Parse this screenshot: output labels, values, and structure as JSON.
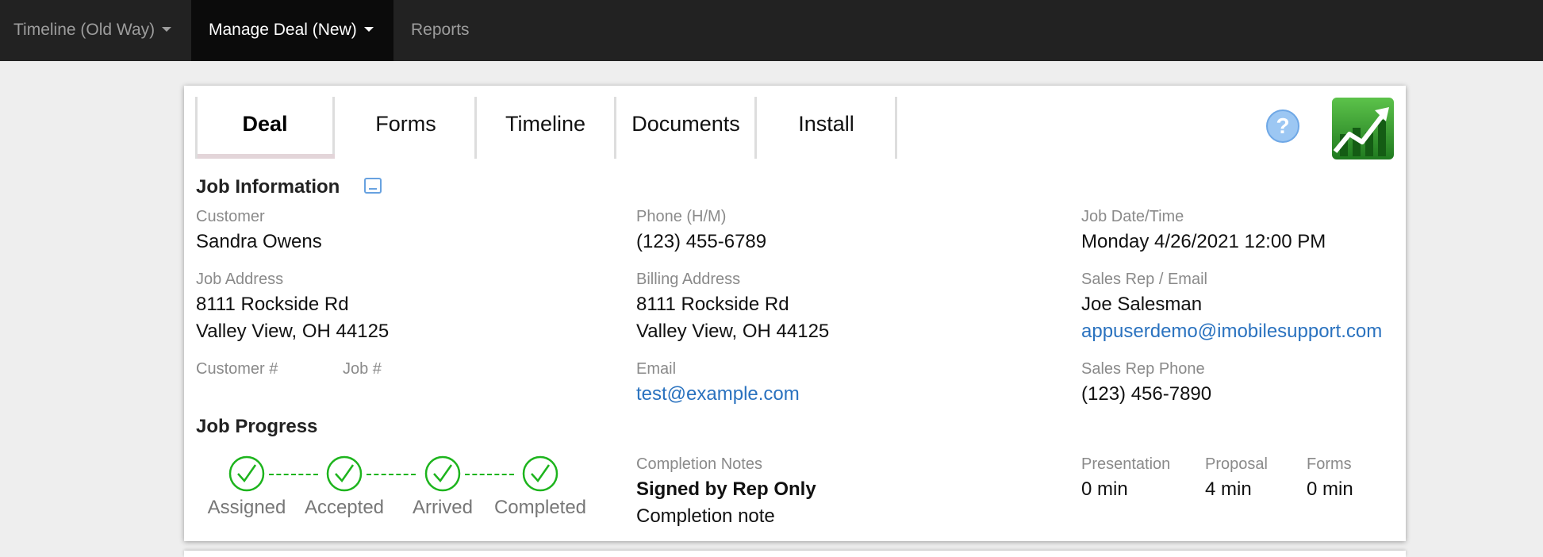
{
  "topnav": {
    "items": [
      {
        "label": "Timeline (Old Way)"
      },
      {
        "label": "Manage Deal (New)"
      },
      {
        "label": "Reports"
      }
    ]
  },
  "tabs": [
    {
      "label": "Deal"
    },
    {
      "label": "Forms"
    },
    {
      "label": "Timeline"
    },
    {
      "label": "Documents"
    },
    {
      "label": "Install"
    }
  ],
  "help": {
    "glyph": "?"
  },
  "job_info": {
    "title": "Job Information",
    "customer_label": "Customer",
    "customer": "Sandra Owens",
    "phone_label": "Phone (H/M)",
    "phone": "(123) 455-6789",
    "job_datetime_label": "Job Date/Time",
    "job_datetime": "Monday 4/26/2021 12:00 PM",
    "job_address_label": "Job Address",
    "job_address_line1": "8111 Rockside Rd",
    "job_address_line2": "Valley View, OH 44125",
    "billing_address_label": "Billing Address",
    "billing_address_line1": "8111 Rockside Rd",
    "billing_address_line2": "Valley View, OH 44125",
    "sales_rep_label": "Sales Rep / Email",
    "sales_rep": "Joe Salesman",
    "sales_rep_email": "appuserdemo@imobilesupport.com",
    "customer_num_label": "Customer #",
    "job_num_label": "Job #",
    "email_label": "Email",
    "email": "test@example.com",
    "sales_rep_phone_label": "Sales Rep Phone",
    "sales_rep_phone": "(123) 456-7890"
  },
  "job_progress": {
    "title": "Job Progress",
    "steps": [
      {
        "label": "Assigned"
      },
      {
        "label": "Accepted"
      },
      {
        "label": "Arrived"
      },
      {
        "label": "Completed"
      }
    ],
    "completion_notes_label": "Completion Notes",
    "completion_status": "Signed by Rep Only",
    "completion_note": "Completion note",
    "presentation_label": "Presentation",
    "presentation": "0 min",
    "proposal_label": "Proposal",
    "proposal": "4 min",
    "forms_label": "Forms",
    "forms": "0 min"
  },
  "colors": {
    "nav_bg": "#222222",
    "check_green": "#1db41d",
    "link_blue": "#2a72bf"
  }
}
